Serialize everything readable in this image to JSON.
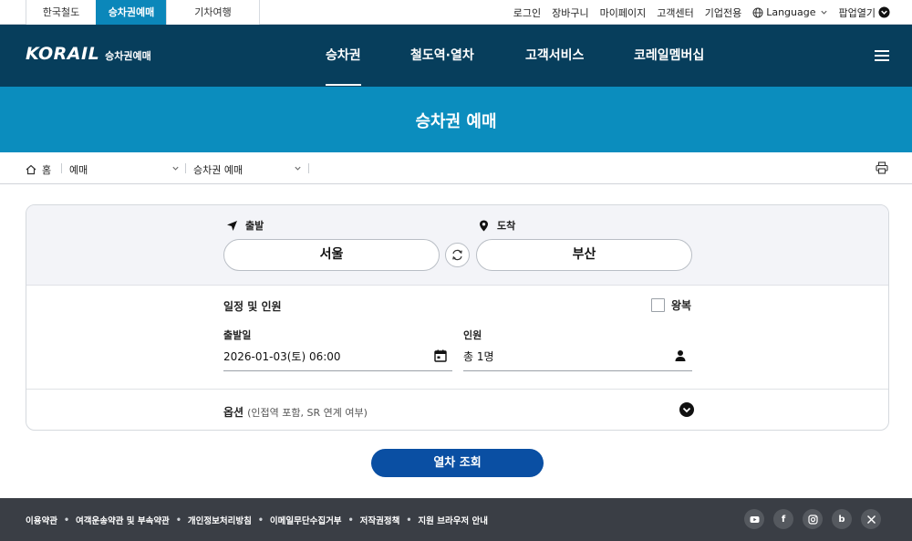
{
  "util": {
    "tabs": [
      "한국철도",
      "승차권예매",
      "기차여행"
    ],
    "links": {
      "login": "로그인",
      "cart": "장바구니",
      "mypage": "마이페이지",
      "customer_center": "고객센터",
      "corporate": "기업전용",
      "language": "Language",
      "popup": "팝업열기"
    }
  },
  "nav": {
    "logo_mark": "KORAIL",
    "logo_sub": "승차권예매",
    "items": [
      "승차권",
      "철도역·열차",
      "고객서비스",
      "코레일멤버십"
    ],
    "active": "승차권"
  },
  "page": {
    "title": "승차권 예매"
  },
  "breadcrumb": {
    "home": "홈",
    "level1": "예매",
    "level2": "승차권 예매"
  },
  "booking": {
    "departure_label": "출발",
    "arrival_label": "도착",
    "departure_station": "서울",
    "arrival_station": "부산",
    "schedule_title": "일정 및 인원",
    "roundtrip_label": "왕복",
    "roundtrip_checked": false,
    "date_label": "출발일",
    "date_value": "2026-01-03(토) 06:00",
    "passenger_label": "인원",
    "passenger_value": "총 1명",
    "option_title": "옵션",
    "option_sub": "(인접역 포함, SR 연계 여부)",
    "search_button": "열차 조회"
  },
  "footer": {
    "links": [
      "이용약관",
      "여객운송약관 및 부속약관",
      "개인정보처리방침",
      "이메일무단수집거부",
      "저작권정책",
      "지원 브라우저 안내"
    ],
    "socials": [
      "youtube-icon",
      "facebook-icon",
      "instagram-icon",
      "blog-icon",
      "x-icon"
    ]
  },
  "colors": {
    "nav_bg": "#073e5c",
    "title_band": "#0b8dbe",
    "active_tab": "#0b87ba",
    "search_button": "#0a4fa3",
    "footer_bg": "#3a3e45"
  }
}
